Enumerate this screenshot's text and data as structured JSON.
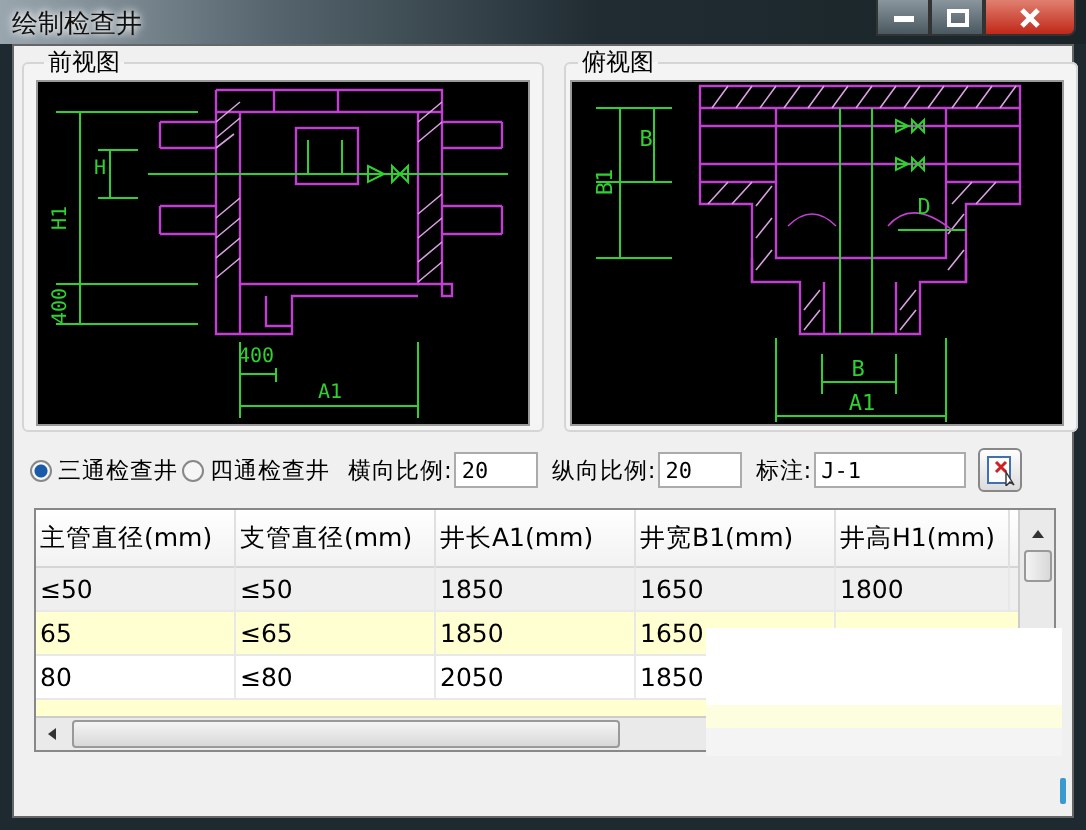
{
  "window": {
    "title": "绘制检查井"
  },
  "front_view": {
    "legend": "前视图",
    "labels": [
      "H1",
      "H",
      "400",
      "400",
      "A1"
    ]
  },
  "top_view": {
    "legend": "俯视图",
    "labels": [
      "B1",
      "B",
      "D",
      "B",
      "A1"
    ]
  },
  "well_types": [
    {
      "label": "三通检查井",
      "selected": true
    },
    {
      "label": "四通检查井",
      "selected": false
    }
  ],
  "fields": [
    {
      "label": "横向比例:",
      "value": "20"
    },
    {
      "label": "纵向比例:",
      "value": "20"
    },
    {
      "label": "标注:",
      "value": "J-1"
    }
  ],
  "table": {
    "columns": [
      "主管直径(mm)",
      "支管直径(mm)",
      "井长A1(mm)",
      "井宽B1(mm)",
      "井高H1(mm)"
    ],
    "rows": [
      {
        "cells": [
          "≤50",
          "≤50",
          "1850",
          "1650",
          "1800"
        ],
        "selected": true
      },
      {
        "cells": [
          "65",
          "≤65",
          "1850",
          "1650"
        ],
        "selected": false
      },
      {
        "cells": [
          "80",
          "≤80",
          "2050",
          "1850"
        ],
        "selected": false
      }
    ]
  }
}
